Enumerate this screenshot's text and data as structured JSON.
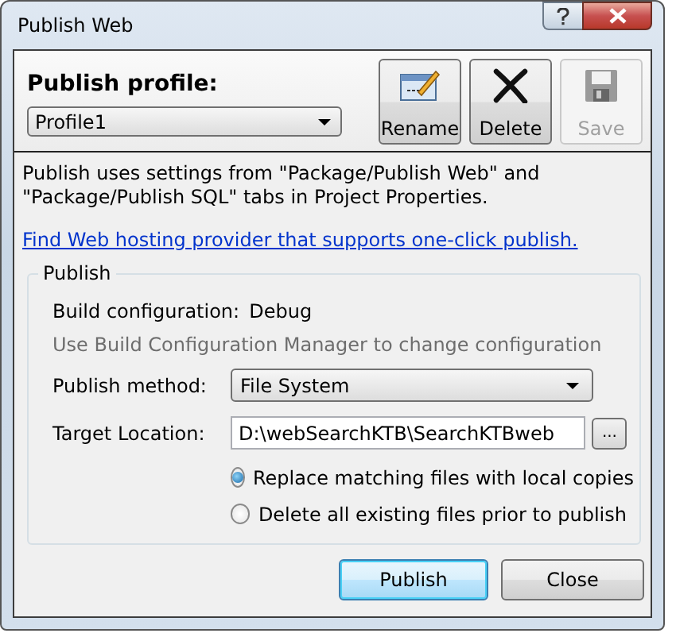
{
  "window": {
    "title": "Publish Web"
  },
  "profile": {
    "label": "Publish profile:",
    "value": "Profile1"
  },
  "toolbar": [
    {
      "kind": "rename",
      "label": "Rename",
      "disabled": false
    },
    {
      "kind": "delete",
      "label": "Delete",
      "disabled": false
    },
    {
      "kind": "save",
      "label": "Save",
      "disabled": true
    }
  ],
  "description": "Publish uses settings from \"Package/Publish Web\" and \"Package/Publish SQL\" tabs in Project Properties.",
  "link": "Find Web hosting provider that supports one-click publish.",
  "group": {
    "title": "Publish",
    "build_label": "Build configuration:",
    "build_value": "Debug",
    "hint": "Use Build Configuration Manager to change configuration",
    "method_label": "Publish method:",
    "method_value": "File System",
    "target_label": "Target Location:",
    "target_value": "D:\\webSearchKTB\\SearchKTBweb",
    "browse_button": "...",
    "options": [
      {
        "label": "Replace matching files with local copies",
        "selected": true
      },
      {
        "label": "Delete all existing files prior to publish",
        "selected": false
      }
    ]
  },
  "buttons": [
    {
      "label": "Publish",
      "default": true
    },
    {
      "label": "Close",
      "default": false
    }
  ]
}
